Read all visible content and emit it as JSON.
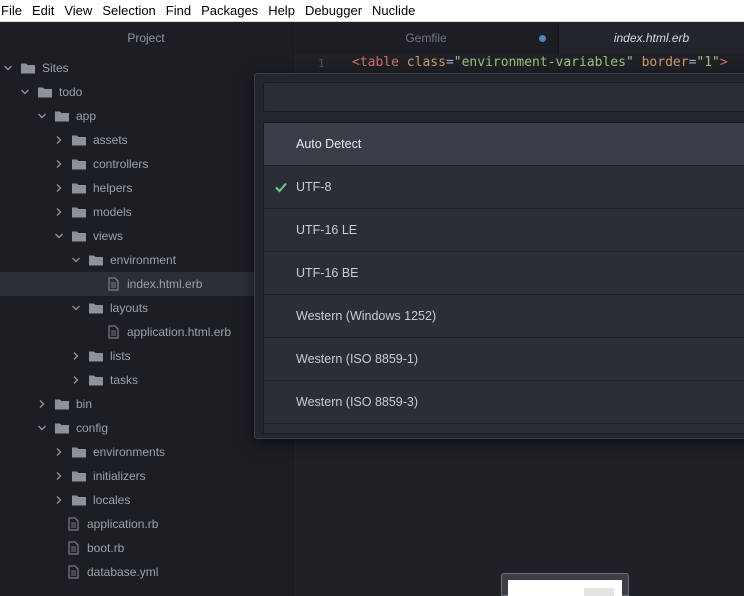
{
  "menu": [
    "File",
    "Edit",
    "View",
    "Selection",
    "Find",
    "Packages",
    "Help",
    "Debugger",
    "Nuclide"
  ],
  "tree": {
    "header": "Project",
    "items": [
      {
        "label": "Sites",
        "depth": 0,
        "kind": "folder",
        "open": true
      },
      {
        "label": "todo",
        "depth": 1,
        "kind": "folder",
        "open": true
      },
      {
        "label": "app",
        "depth": 2,
        "kind": "folder",
        "open": true
      },
      {
        "label": "assets",
        "depth": 3,
        "kind": "folder",
        "open": false
      },
      {
        "label": "controllers",
        "depth": 3,
        "kind": "folder",
        "open": false
      },
      {
        "label": "helpers",
        "depth": 3,
        "kind": "folder",
        "open": false
      },
      {
        "label": "models",
        "depth": 3,
        "kind": "folder",
        "open": false
      },
      {
        "label": "views",
        "depth": 3,
        "kind": "folder",
        "open": true
      },
      {
        "label": "environment",
        "depth": 4,
        "kind": "folder",
        "open": true
      },
      {
        "label": "index.html.erb",
        "depth": 5,
        "kind": "file",
        "selected": true
      },
      {
        "label": "layouts",
        "depth": 4,
        "kind": "folder",
        "open": true
      },
      {
        "label": "application.html.erb",
        "depth": 5,
        "kind": "file"
      },
      {
        "label": "lists",
        "depth": 4,
        "kind": "folder",
        "open": false
      },
      {
        "label": "tasks",
        "depth": 4,
        "kind": "folder",
        "open": false
      },
      {
        "label": "bin",
        "depth": 2,
        "kind": "folder",
        "open": false
      },
      {
        "label": "config",
        "depth": 2,
        "kind": "folder",
        "open": true
      },
      {
        "label": "environments",
        "depth": 3,
        "kind": "folder",
        "open": false
      },
      {
        "label": "initializers",
        "depth": 3,
        "kind": "folder",
        "open": false
      },
      {
        "label": "locales",
        "depth": 3,
        "kind": "folder",
        "open": false
      },
      {
        "label": "application.rb",
        "depth": 3,
        "kind": "file"
      },
      {
        "label": "boot.rb",
        "depth": 3,
        "kind": "file"
      },
      {
        "label": "database.yml",
        "depth": 3,
        "kind": "file"
      }
    ]
  },
  "tabs": [
    {
      "label": "Gemfile",
      "modified": true
    },
    {
      "label": "index.html.erb",
      "active": true
    }
  ],
  "editor": {
    "line_number": "1",
    "tokens": [
      {
        "text": "<table ",
        "kind": "tag"
      },
      {
        "text": "class",
        "kind": "attr"
      },
      {
        "text": "=",
        "kind": "punc"
      },
      {
        "text": "\"environment-variables\"",
        "kind": "str"
      },
      {
        "text": " border",
        "kind": "attr"
      },
      {
        "text": "=",
        "kind": "punc"
      },
      {
        "text": "\"1\"",
        "kind": "str"
      },
      {
        "text": ">",
        "kind": "tag"
      }
    ]
  },
  "encoding_selector": {
    "query": "",
    "items": [
      {
        "label": "Auto Detect",
        "selected": true
      },
      {
        "label": "UTF-8",
        "checked": true
      },
      {
        "label": "UTF-16 LE"
      },
      {
        "label": "UTF-16 BE"
      },
      {
        "label": "Western (Windows 1252)"
      },
      {
        "label": "Western (ISO 8859-1)"
      },
      {
        "label": "Western (ISO 8859-3)"
      }
    ]
  },
  "colors": {
    "check": "#73c990",
    "modified_dot": "#4f87c8",
    "selection": "#3a3e48"
  }
}
